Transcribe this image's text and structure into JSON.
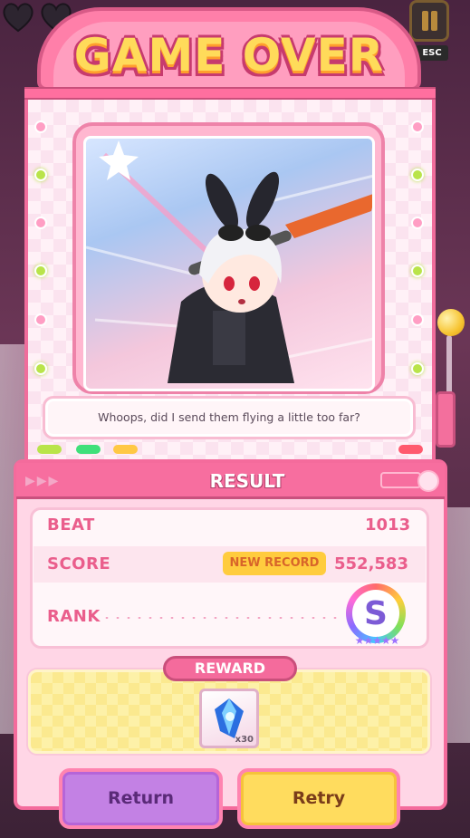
{
  "title": "GAME OVER",
  "pause": {
    "esc_label": "ESC"
  },
  "hearts": {
    "count": 2
  },
  "dialogue": {
    "text": "Whoops, did I send them flying a little too far?"
  },
  "result": {
    "header": "RESULT",
    "beat_label": "BEAT",
    "beat_value": "1013",
    "score_label": "SCORE",
    "new_record_badge": "NEW RECORD",
    "score_value": "552,583",
    "rank_label": "RANK",
    "rank_value": "S"
  },
  "reward": {
    "label": "REWARD",
    "item_icon": "blue-crystal-icon",
    "item_count": "x30"
  },
  "buttons": {
    "return": "Return",
    "retry": "Retry"
  },
  "colors": {
    "accent_pink": "#f46b9c",
    "gold": "#ffdb5a",
    "return_purple": "#c381e4",
    "retry_yellow": "#ffdc5e"
  }
}
